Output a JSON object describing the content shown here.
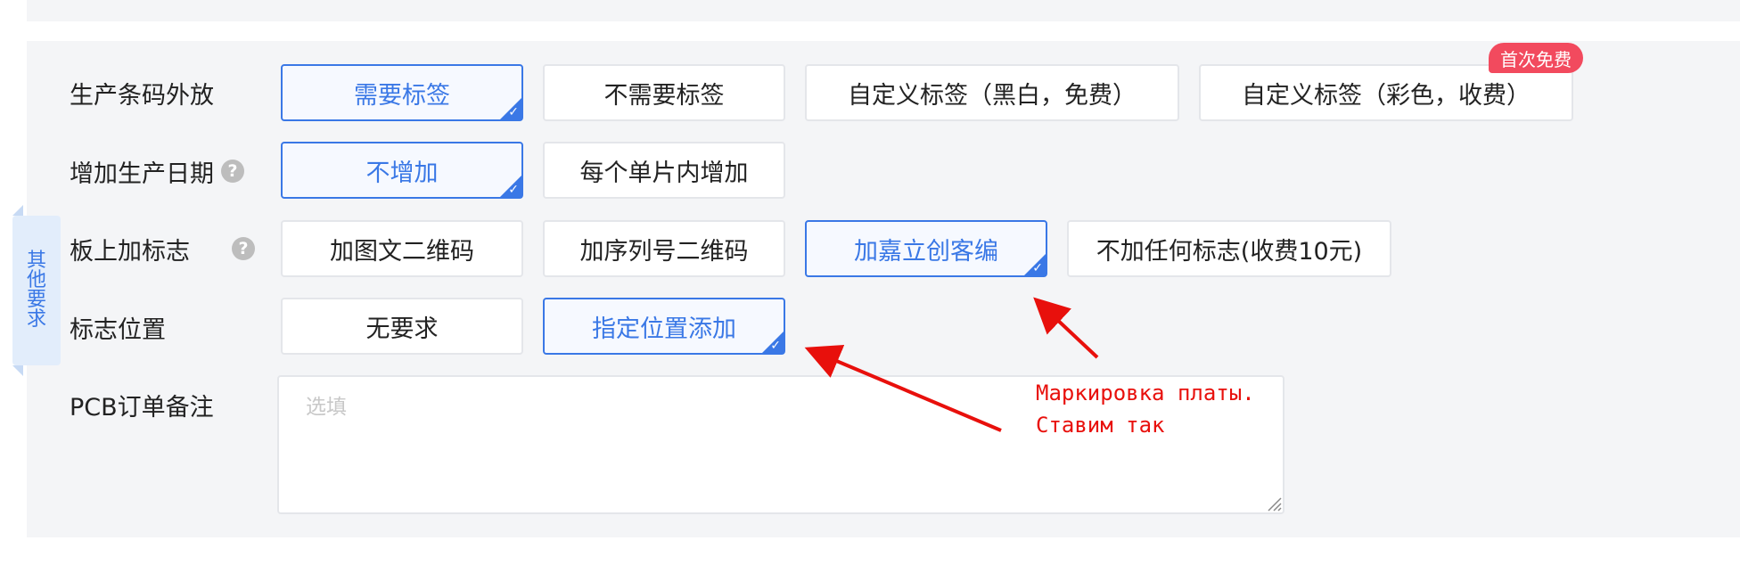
{
  "side_tab": {
    "chars": [
      "其",
      "他",
      "要",
      "求"
    ]
  },
  "rows": {
    "barcode": {
      "label": "生产条码外放",
      "options": [
        "需要标签",
        "不需要标签",
        "自定义标签（黑白，免费）",
        "自定义标签（彩色，收费）"
      ],
      "selected": "需要标签",
      "badge": "首次免费"
    },
    "date": {
      "label": "增加生产日期",
      "options": [
        "不增加",
        "每个单片内增加"
      ],
      "selected": "不增加"
    },
    "marking": {
      "label": "板上加标志",
      "options": [
        "加图文二维码",
        "加序列号二维码",
        "加嘉立创客编",
        "不加任何标志(收费10元)"
      ],
      "selected": "加嘉立创客编"
    },
    "position": {
      "label": "标志位置",
      "options": [
        "无要求",
        "指定位置添加"
      ],
      "selected": "指定位置添加"
    },
    "notes": {
      "label": "PCB订单备注",
      "placeholder": "选填",
      "value": ""
    }
  },
  "annotation": {
    "line1": "Маркировка платы.",
    "line2": "Ставим так",
    "color": "#e8100c"
  },
  "colors": {
    "accent": "#3a78e6",
    "badge": "#f24a5e",
    "panel_bg": "#f4f5f7",
    "side_tab_bg": "#e2edfb"
  },
  "icons": {
    "help": "question-circle-icon",
    "check": "check-corner-icon"
  }
}
